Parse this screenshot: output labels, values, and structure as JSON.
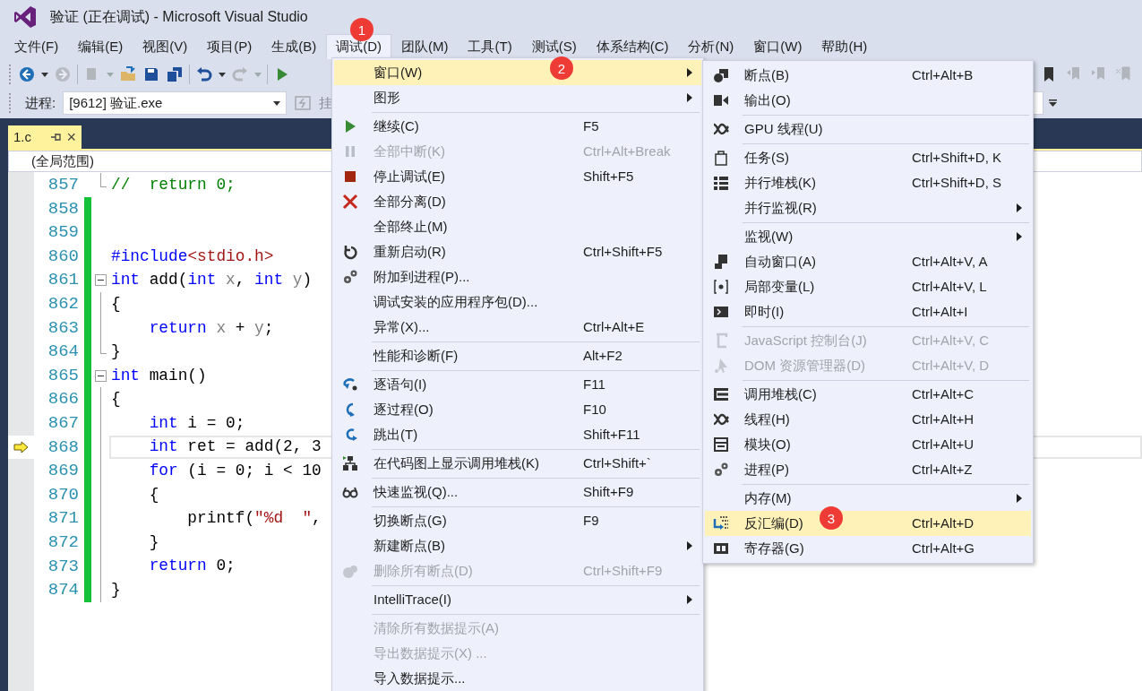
{
  "window": {
    "title": "验证 (正在调试) - Microsoft Visual Studio"
  },
  "menubar": [
    {
      "label": "文件(F)",
      "selected": false
    },
    {
      "label": "编辑(E)",
      "selected": false
    },
    {
      "label": "视图(V)",
      "selected": false
    },
    {
      "label": "项目(P)",
      "selected": false
    },
    {
      "label": "生成(B)",
      "selected": false
    },
    {
      "label": "调试(D)",
      "selected": true,
      "badge": "1"
    },
    {
      "label": "团队(M)",
      "selected": false
    },
    {
      "label": "工具(T)",
      "selected": false
    },
    {
      "label": "测试(S)",
      "selected": false
    },
    {
      "label": "体系结构(C)",
      "selected": false
    },
    {
      "label": "分析(N)",
      "selected": false
    },
    {
      "label": "窗口(W)",
      "selected": false
    },
    {
      "label": "帮助(H)",
      "selected": false
    }
  ],
  "process_bar": {
    "label": "进程:",
    "value": "[9612] 验证.exe",
    "cut_button": "挂"
  },
  "document_tab": {
    "title": "1.c",
    "close": "×"
  },
  "scope": "(全局范围)",
  "code_lines": [
    {
      "number": "857",
      "changed": false,
      "block_end": true,
      "current": false,
      "tokens": [
        {
          "kind": "comment",
          "text": "//  return 0;"
        }
      ]
    },
    {
      "number": "858",
      "changed": true,
      "block_end": false,
      "current": false
    },
    {
      "number": "859",
      "changed": true,
      "block_end": false,
      "current": false
    },
    {
      "number": "860",
      "changed": true,
      "block_end": false,
      "current": false,
      "tokens": [
        {
          "kind": "keyword",
          "text": "#include"
        },
        {
          "kind": "string",
          "text": "<stdio.h>"
        }
      ]
    },
    {
      "number": "861",
      "changed": true,
      "current": false,
      "tokens": [
        {
          "kind": "keyword",
          "text": "int"
        },
        {
          "kind": "plain",
          "text": " add("
        },
        {
          "kind": "keyword",
          "text": "int"
        },
        {
          "kind": "param",
          "text": " x"
        },
        {
          "kind": "plain",
          "text": ", "
        },
        {
          "kind": "keyword",
          "text": "int"
        },
        {
          "kind": "param",
          "text": " y"
        },
        {
          "kind": "plain",
          "text": ")"
        }
      ],
      "children": [
        {
          "number": "862",
          "changed": true,
          "block_end": false,
          "current": false,
          "tokens": [
            {
              "kind": "plain",
              "text": "{"
            }
          ]
        },
        {
          "number": "863",
          "changed": true,
          "block_end": false,
          "current": false,
          "tokens": [
            {
              "kind": "keyword",
              "text": "    return"
            },
            {
              "kind": "param",
              "text": " x"
            },
            {
              "kind": "plain",
              "text": " + "
            },
            {
              "kind": "param",
              "text": "y"
            },
            {
              "kind": "plain",
              "text": ";"
            }
          ]
        },
        {
          "number": "864",
          "changed": true,
          "block_end": true,
          "current": false,
          "tokens": [
            {
              "kind": "plain",
              "text": "}"
            }
          ]
        }
      ]
    },
    {
      "number": "865",
      "changed": true,
      "current": false,
      "tokens": [
        {
          "kind": "keyword",
          "text": "int"
        },
        {
          "kind": "plain",
          "text": " main()"
        }
      ],
      "children": [
        {
          "number": "866",
          "changed": true,
          "block_end": false,
          "current": false,
          "tokens": [
            {
              "kind": "plain",
              "text": "{"
            }
          ]
        },
        {
          "number": "867",
          "changed": true,
          "block_end": false,
          "current": false,
          "tokens": [
            {
              "kind": "keyword",
              "text": "    int"
            },
            {
              "kind": "plain",
              "text": " i = 0;"
            }
          ]
        },
        {
          "number": "868",
          "changed": true,
          "block_end": false,
          "current": true,
          "tokens": [
            {
              "kind": "keyword",
              "text": "    int"
            },
            {
              "kind": "plain",
              "text": " ret = add(2, 3"
            }
          ]
        },
        {
          "number": "869",
          "changed": true,
          "block_end": false,
          "current": false,
          "tokens": [
            {
              "kind": "keyword",
              "text": "    for"
            },
            {
              "kind": "plain",
              "text": " (i = 0; i < 10"
            }
          ]
        },
        {
          "number": "870",
          "changed": true,
          "block_end": false,
          "current": false,
          "tokens": [
            {
              "kind": "plain",
              "text": "    {"
            }
          ]
        },
        {
          "number": "871",
          "changed": true,
          "block_end": false,
          "current": false,
          "tokens": [
            {
              "kind": "plain",
              "text": "        printf("
            },
            {
              "kind": "string",
              "text": "\"%d  \""
            },
            {
              "kind": "plain",
              "text": ","
            }
          ]
        },
        {
          "number": "872",
          "changed": true,
          "block_end": false,
          "current": false,
          "tokens": [
            {
              "kind": "plain",
              "text": "    }"
            }
          ]
        },
        {
          "number": "873",
          "changed": true,
          "block_end": false,
          "current": false,
          "tokens": [
            {
              "kind": "keyword",
              "text": "    return"
            },
            {
              "kind": "plain",
              "text": " 0;"
            }
          ]
        },
        {
          "number": "874",
          "changed": true,
          "block_end": false,
          "current": false,
          "tokens": [
            {
              "kind": "plain",
              "text": "}"
            }
          ]
        }
      ]
    }
  ],
  "debug_menu": [
    {
      "kind": "item",
      "label": "窗口(W)",
      "selected": true,
      "disabled": false,
      "submenu": true,
      "badge": "2"
    },
    {
      "kind": "item",
      "label": "图形",
      "selected": false,
      "disabled": false,
      "submenu": true
    },
    {
      "kind": "separator"
    },
    {
      "kind": "item",
      "label": "继续(C)",
      "shortcut": "F5",
      "selected": false,
      "disabled": false,
      "submenu": false
    },
    {
      "kind": "item",
      "label": "全部中断(K)",
      "shortcut": "Ctrl+Alt+Break",
      "selected": false,
      "disabled": true,
      "submenu": false
    },
    {
      "kind": "item",
      "label": "停止调试(E)",
      "shortcut": "Shift+F5",
      "selected": false,
      "disabled": false,
      "submenu": false
    },
    {
      "kind": "item",
      "label": "全部分离(D)",
      "selected": false,
      "disabled": false,
      "submenu": false
    },
    {
      "kind": "item",
      "label": "全部终止(M)",
      "selected": false,
      "disabled": false,
      "submenu": false
    },
    {
      "kind": "item",
      "label": "重新启动(R)",
      "shortcut": "Ctrl+Shift+F5",
      "selected": false,
      "disabled": false,
      "submenu": false
    },
    {
      "kind": "item",
      "label": "附加到进程(P)...",
      "selected": false,
      "disabled": false,
      "submenu": false
    },
    {
      "kind": "item",
      "label": "调试安装的应用程序包(D)...",
      "selected": false,
      "disabled": false,
      "submenu": false
    },
    {
      "kind": "item",
      "label": "异常(X)...",
      "shortcut": "Ctrl+Alt+E",
      "selected": false,
      "disabled": false,
      "submenu": false
    },
    {
      "kind": "separator"
    },
    {
      "kind": "item",
      "label": "性能和诊断(F)",
      "shortcut": "Alt+F2",
      "selected": false,
      "disabled": false,
      "submenu": false
    },
    {
      "kind": "separator"
    },
    {
      "kind": "item",
      "label": "逐语句(I)",
      "shortcut": "F11",
      "selected": false,
      "disabled": false,
      "submenu": false
    },
    {
      "kind": "item",
      "label": "逐过程(O)",
      "shortcut": "F10",
      "selected": false,
      "disabled": false,
      "submenu": false
    },
    {
      "kind": "item",
      "label": "跳出(T)",
      "shortcut": "Shift+F11",
      "selected": false,
      "disabled": false,
      "submenu": false
    },
    {
      "kind": "separator"
    },
    {
      "kind": "item",
      "label": "在代码图上显示调用堆栈(K)",
      "shortcut": "Ctrl+Shift+`",
      "selected": false,
      "disabled": false,
      "submenu": false
    },
    {
      "kind": "separator"
    },
    {
      "kind": "item",
      "label": "快速监视(Q)...",
      "shortcut": "Shift+F9",
      "selected": false,
      "disabled": false,
      "submenu": false
    },
    {
      "kind": "separator"
    },
    {
      "kind": "item",
      "label": "切换断点(G)",
      "shortcut": "F9",
      "selected": false,
      "disabled": false,
      "submenu": false
    },
    {
      "kind": "item",
      "label": "新建断点(B)",
      "selected": false,
      "disabled": false,
      "submenu": true
    },
    {
      "kind": "item",
      "label": "删除所有断点(D)",
      "shortcut": "Ctrl+Shift+F9",
      "selected": false,
      "disabled": true,
      "submenu": false
    },
    {
      "kind": "separator"
    },
    {
      "kind": "item",
      "label": "IntelliTrace(I)",
      "selected": false,
      "disabled": false,
      "submenu": true
    },
    {
      "kind": "separator"
    },
    {
      "kind": "item",
      "label": "清除所有数据提示(A)",
      "selected": false,
      "disabled": true,
      "submenu": false
    },
    {
      "kind": "item",
      "label": "导出数据提示(X) ...",
      "selected": false,
      "disabled": true,
      "submenu": false
    },
    {
      "kind": "item",
      "label": "导入数据提示...",
      "selected": false,
      "disabled": false,
      "submenu": false
    }
  ],
  "window_submenu": [
    {
      "kind": "item",
      "label": "断点(B)",
      "shortcut": "Ctrl+Alt+B",
      "selected": false,
      "disabled": false,
      "submenu": false
    },
    {
      "kind": "item",
      "label": "输出(O)",
      "selected": false,
      "disabled": false,
      "submenu": false
    },
    {
      "kind": "separator"
    },
    {
      "kind": "item",
      "label": "GPU 线程(U)",
      "selected": false,
      "disabled": false,
      "submenu": false
    },
    {
      "kind": "separator"
    },
    {
      "kind": "item",
      "label": "任务(S)",
      "shortcut": "Ctrl+Shift+D, K",
      "selected": false,
      "disabled": false,
      "submenu": false
    },
    {
      "kind": "item",
      "label": "并行堆栈(K)",
      "shortcut": "Ctrl+Shift+D, S",
      "selected": false,
      "disabled": false,
      "submenu": false
    },
    {
      "kind": "item",
      "label": "并行监视(R)",
      "selected": false,
      "disabled": false,
      "submenu": true
    },
    {
      "kind": "separator"
    },
    {
      "kind": "item",
      "label": "监视(W)",
      "selected": false,
      "disabled": false,
      "submenu": true
    },
    {
      "kind": "item",
      "label": "自动窗口(A)",
      "shortcut": "Ctrl+Alt+V, A",
      "selected": false,
      "disabled": false,
      "submenu": false
    },
    {
      "kind": "item",
      "label": "局部变量(L)",
      "shortcut": "Ctrl+Alt+V, L",
      "selected": false,
      "disabled": false,
      "submenu": false
    },
    {
      "kind": "item",
      "label": "即时(I)",
      "shortcut": "Ctrl+Alt+I",
      "selected": false,
      "disabled": false,
      "submenu": false
    },
    {
      "kind": "separator"
    },
    {
      "kind": "item",
      "label": "JavaScript 控制台(J)",
      "shortcut": "Ctrl+Alt+V, C",
      "selected": false,
      "disabled": true,
      "submenu": false
    },
    {
      "kind": "item",
      "label": "DOM 资源管理器(D)",
      "shortcut": "Ctrl+Alt+V, D",
      "selected": false,
      "disabled": true,
      "submenu": false
    },
    {
      "kind": "separator"
    },
    {
      "kind": "item",
      "label": "调用堆栈(C)",
      "shortcut": "Ctrl+Alt+C",
      "selected": false,
      "disabled": false,
      "submenu": false
    },
    {
      "kind": "item",
      "label": "线程(H)",
      "shortcut": "Ctrl+Alt+H",
      "selected": false,
      "disabled": false,
      "submenu": false
    },
    {
      "kind": "item",
      "label": "模块(O)",
      "shortcut": "Ctrl+Alt+U",
      "selected": false,
      "disabled": false,
      "submenu": false
    },
    {
      "kind": "item",
      "label": "进程(P)",
      "shortcut": "Ctrl+Alt+Z",
      "selected": false,
      "disabled": false,
      "submenu": false
    },
    {
      "kind": "separator"
    },
    {
      "kind": "item",
      "label": "内存(M)",
      "selected": false,
      "disabled": false,
      "submenu": true
    },
    {
      "kind": "item",
      "label": "反汇编(D)",
      "shortcut": "Ctrl+Alt+D",
      "selected": true,
      "disabled": false,
      "submenu": false,
      "badge": "3"
    },
    {
      "kind": "item",
      "label": "寄存器(G)",
      "shortcut": "Ctrl+Alt+G",
      "selected": false,
      "disabled": false,
      "submenu": false
    }
  ]
}
